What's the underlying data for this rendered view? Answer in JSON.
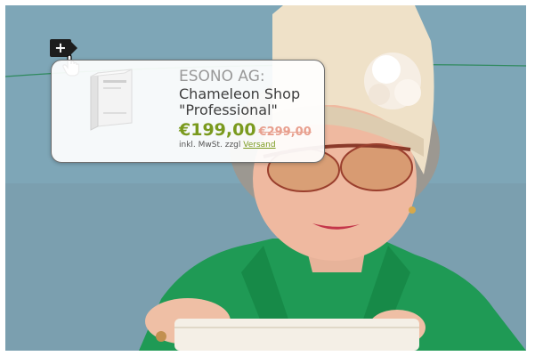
{
  "hotspot": {
    "icon": "plus-icon",
    "glyph": "+"
  },
  "tooltip": {
    "vendor": "ESONO AG:",
    "product_name": "Chameleon Shop \"Professional\"",
    "price_current": "€199,00",
    "price_original": "€299,00",
    "tax_note": "inkl. MwSt. zzgl",
    "shipping_link": "Versand"
  },
  "colors": {
    "price_current": "#7a9a1e",
    "price_original": "#e8a08f",
    "background": "#7fa7b8",
    "jacket": "#1f9a55"
  }
}
